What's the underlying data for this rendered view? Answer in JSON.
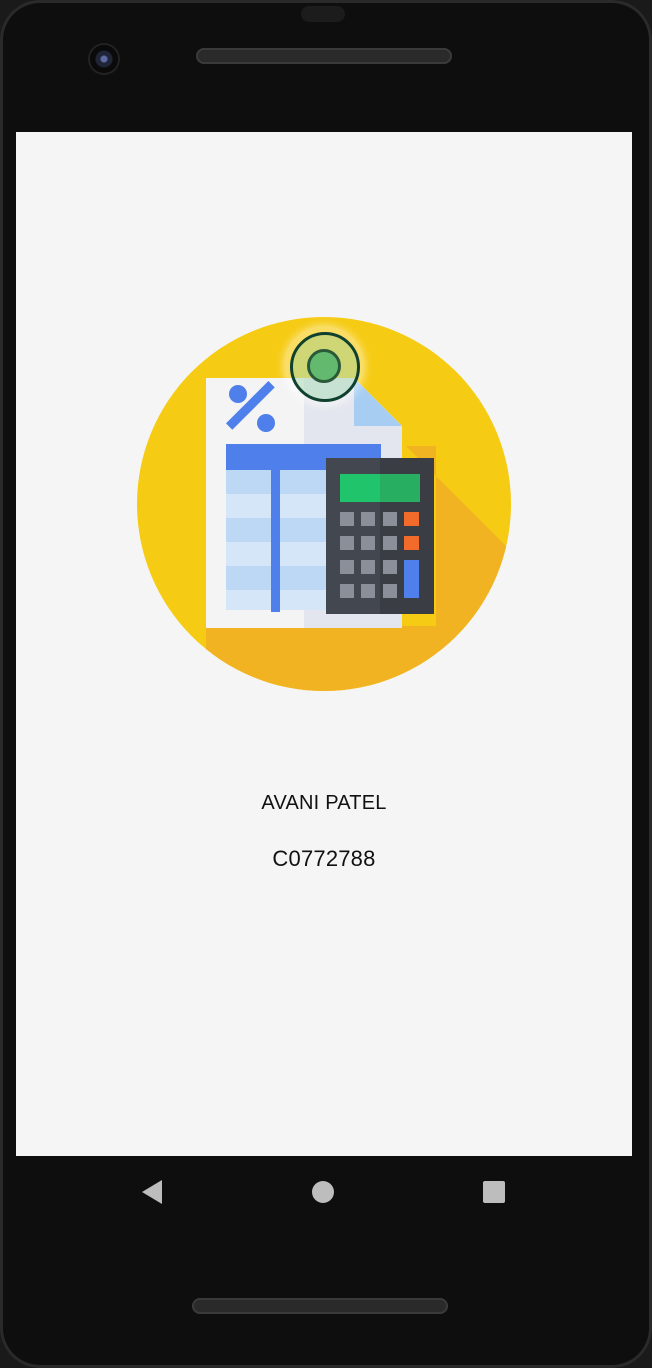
{
  "profile": {
    "name": "AVANI PATEL",
    "id": "C0772788"
  },
  "logo": {
    "icon": "tax-calculator-icon",
    "colors": {
      "circle": "#F6CB13",
      "shadow": "#F2B322",
      "doc_blue": "#4F7FEA",
      "calc_body": "#43474F",
      "calc_screen": "#20C56B",
      "calc_accent": "#F36B2A"
    }
  },
  "navigation": {
    "back_icon": "back-triangle-icon",
    "home_icon": "home-circle-icon",
    "recent_icon": "recent-apps-square-icon"
  },
  "colors": {
    "screen_bg": "#F5F5F5",
    "text": "#111111",
    "device_bezel": "#0E0E0E"
  }
}
